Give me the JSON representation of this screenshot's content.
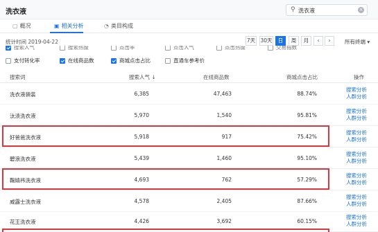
{
  "header": {
    "title": "洗衣液",
    "search_value": "洗衣液",
    "search_icon": "search-icon",
    "clear_icon": "clear-icon"
  },
  "tabs": [
    {
      "label": "概况",
      "icon": "overview-icon"
    },
    {
      "label": "相关分析",
      "icon": "related-icon",
      "active": true
    },
    {
      "label": "类目构成",
      "icon": "category-icon"
    }
  ],
  "stat_time": "统计时间 2019-04-22",
  "periods": [
    "7天",
    "30天",
    "日",
    "周",
    "月"
  ],
  "active_period": "日",
  "all_terminals": "所有终端",
  "partial_options": [
    "搜索人气",
    "搜索热度",
    "点击率",
    "点击人气",
    "点击热度",
    "交易指数"
  ],
  "options": [
    {
      "label": "支付转化率",
      "checked": false
    },
    {
      "label": "在线商品数",
      "checked": true
    },
    {
      "label": "商城点击占比",
      "checked": true
    },
    {
      "label": "直通车参考价",
      "checked": false
    }
  ],
  "table": {
    "columns": [
      "搜索词",
      "搜索人气",
      "在线商品数",
      "商城点击占比",
      "操作"
    ],
    "sort_indicator": "↓",
    "rows": [
      {
        "keyword": "洗衣液袋装",
        "popularity": "6,385",
        "items": "47,463",
        "ratio": "88.74%"
      },
      {
        "keyword": "汰渍洗衣液",
        "popularity": "5,970",
        "items": "1,540",
        "ratio": "95.81%"
      },
      {
        "keyword": "好爸爸洗衣液",
        "popularity": "5,918",
        "items": "917",
        "ratio": "75.42%"
      },
      {
        "keyword": "碧浪洗衣液",
        "popularity": "5,439",
        "items": "1,460",
        "ratio": "95.10%"
      },
      {
        "keyword": "鞠婧祎洗衣液",
        "popularity": "4,693",
        "items": "762",
        "ratio": "57.29%"
      },
      {
        "keyword": "威露士洗衣液",
        "popularity": "4,578",
        "items": "2,405",
        "ratio": "87.66%"
      },
      {
        "keyword": "花王洗衣液",
        "popularity": "4,426",
        "items": "3,692",
        "ratio": "60.15%"
      }
    ],
    "action_1": "搜索分析",
    "action_2": "人群分析"
  }
}
